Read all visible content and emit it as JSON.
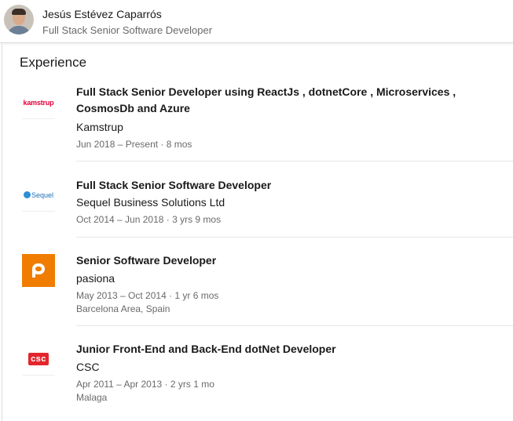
{
  "profile": {
    "name": "Jesús Estévez Caparrós",
    "headline": "Full Stack Senior Software Developer"
  },
  "section": {
    "title": "Experience"
  },
  "experience": [
    {
      "title": "Full Stack Senior Developer using ReactJs , dotnetCore , Microservices , CosmosDb and Azure",
      "company": "Kamstrup",
      "dates": "Jun 2018 – Present · 8 mos",
      "location": "",
      "logo_text": "kamstrup",
      "logo_icon": "kamstrup-logo-icon"
    },
    {
      "title": "Full Stack Senior Software Developer",
      "company": "Sequel Business Solutions Ltd",
      "dates": "Oct 2014 – Jun 2018 · 3 yrs 9 mos",
      "location": "",
      "logo_text": "Sequel",
      "logo_icon": "sequel-logo-icon"
    },
    {
      "title": "Senior Software Developer",
      "company": "pasiona",
      "dates": "May 2013 – Oct 2014 · 1 yr 6 mos",
      "location": "Barcelona Area, Spain",
      "logo_text": "",
      "logo_icon": "pasiona-logo-icon"
    },
    {
      "title": "Junior Front-End and Back-End dotNet Developer",
      "company": "CSC",
      "dates": "Apr 2011 – Apr 2013 · 2 yrs 1 mo",
      "location": "Malaga",
      "logo_text": "csc",
      "logo_icon": "csc-logo-icon"
    }
  ],
  "colors": {
    "kamstrup_red": "#e4003a",
    "pasiona_orange": "#f07d00",
    "csc_red": "#e3262d",
    "sequel_blue": "#1f6fb5"
  }
}
